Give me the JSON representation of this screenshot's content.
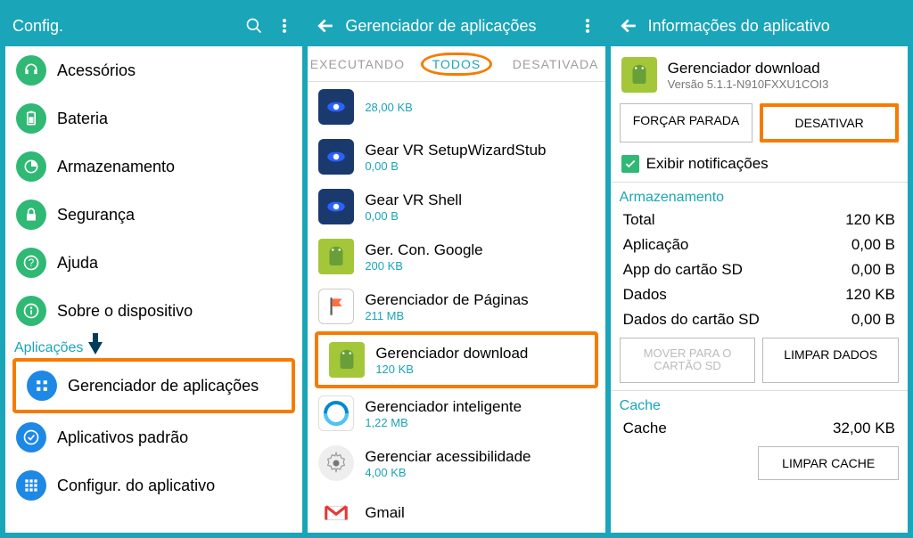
{
  "panel1": {
    "title": "Config.",
    "items_top": [
      {
        "label": "Acessórios",
        "color": "green",
        "icon": "headphone"
      },
      {
        "label": "Bateria",
        "color": "green",
        "icon": "battery"
      },
      {
        "label": "Armazenamento",
        "color": "green",
        "icon": "storage"
      },
      {
        "label": "Segurança",
        "color": "green",
        "icon": "lock"
      },
      {
        "label": "Ajuda",
        "color": "green",
        "icon": "help"
      },
      {
        "label": "Sobre o dispositivo",
        "color": "green",
        "icon": "info"
      }
    ],
    "section": "Aplicações",
    "items_apps": [
      {
        "label": "Gerenciador de aplicações",
        "color": "blue",
        "hl": true,
        "icon": "grid"
      },
      {
        "label": "Aplicativos padrão",
        "color": "blue",
        "icon": "check"
      },
      {
        "label": "Configur. do aplicativo",
        "color": "blue",
        "icon": "dots"
      }
    ]
  },
  "panel2": {
    "title": "Gerenciador de aplicações",
    "tabs": [
      "EXECUTANDO",
      "TODOS",
      "DESATIVADA"
    ],
    "apps": [
      {
        "name": "",
        "size": "28,00 KB",
        "icon": "samsung"
      },
      {
        "name": "Gear VR SetupWizardStub",
        "size": "0,00 B",
        "icon": "samsung"
      },
      {
        "name": "Gear VR Shell",
        "size": "0,00 B",
        "icon": "samsung"
      },
      {
        "name": "Ger. Con. Google",
        "size": "200 KB",
        "icon": "android"
      },
      {
        "name": "Gerenciador de Páginas",
        "size": "211 MB",
        "icon": "flag"
      },
      {
        "name": "Gerenciador download",
        "size": "120 KB",
        "icon": "download",
        "hl": true
      },
      {
        "name": "Gerenciador inteligente",
        "size": "1,22 MB",
        "icon": "smart"
      },
      {
        "name": "Gerenciar acessibilidade",
        "size": "4,00 KB",
        "icon": "gear"
      },
      {
        "name": "Gmail",
        "size": "",
        "icon": "gmail"
      }
    ]
  },
  "panel3": {
    "title": "Informações do aplicativo",
    "app_name": "Gerenciador download",
    "version": "Versão 5.1.1-N910FXXU1COI3",
    "btn_force": "FORÇAR PARADA",
    "btn_disable": "DESATIVAR",
    "chk_notif": "Exibir notificações",
    "storage_hdr": "Armazenamento",
    "storage": [
      {
        "k": "Total",
        "v": "120 KB"
      },
      {
        "k": "Aplicação",
        "v": "0,00 B"
      },
      {
        "k": "App do cartão SD",
        "v": "0,00 B"
      },
      {
        "k": "Dados",
        "v": "120 KB"
      },
      {
        "k": "Dados do cartão SD",
        "v": "0,00 B"
      }
    ],
    "btn_move": "MOVER PARA O CARTÃO SD",
    "btn_clear_data": "LIMPAR DADOS",
    "cache_hdr": "Cache",
    "cache_k": "Cache",
    "cache_v": "32,00 KB",
    "btn_clear_cache": "LIMPAR CACHE"
  }
}
